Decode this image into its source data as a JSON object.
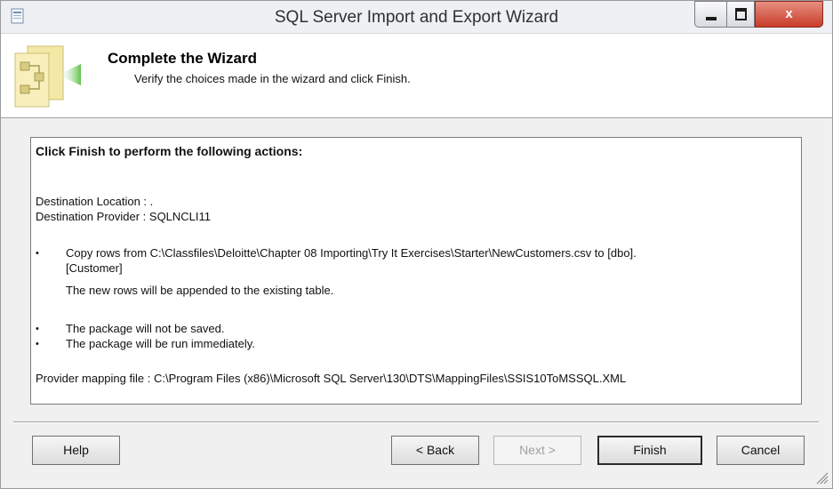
{
  "window": {
    "title": "SQL Server Import and Export Wizard",
    "close_label": "x"
  },
  "header": {
    "title": "Complete the Wizard",
    "subtitle": "Verify the choices made in the wizard and click Finish."
  },
  "summary": {
    "heading": "Click Finish to perform the following actions:",
    "destination_location": "Destination Location : .",
    "destination_provider": "Destination Provider : SQLNCLI11",
    "copy_rows_line1": "Copy rows from C:\\Classfiles\\Deloitte\\Chapter 08 Importing\\Try It Exercises\\Starter\\NewCustomers.csv to [dbo].",
    "copy_rows_line2": "[Customer]",
    "append_note": "The new rows will be appended to the existing table.",
    "not_saved": "The package will not be saved.",
    "run_immediately": "The package will be run immediately.",
    "mapping_file": "Provider mapping file : C:\\Program Files (x86)\\Microsoft SQL Server\\130\\DTS\\MappingFiles\\SSIS10ToMSSQL.XML",
    "bullet_glyph": "•"
  },
  "buttons": {
    "help": "Help",
    "back": "< Back",
    "next": "Next >",
    "finish": "Finish",
    "cancel": "Cancel"
  },
  "icons": {
    "app": "app-window-icon",
    "wizard": "wizard-flowchart-icon",
    "minimize": "minimize-icon",
    "maximize": "maximize-icon",
    "close": "close-icon",
    "grip": "resize-grip-icon"
  },
  "colors": {
    "close_button": "#c73d28",
    "wizard_icon_green": "#5fc24a",
    "wizard_icon_yellow": "#f4e8a6"
  }
}
